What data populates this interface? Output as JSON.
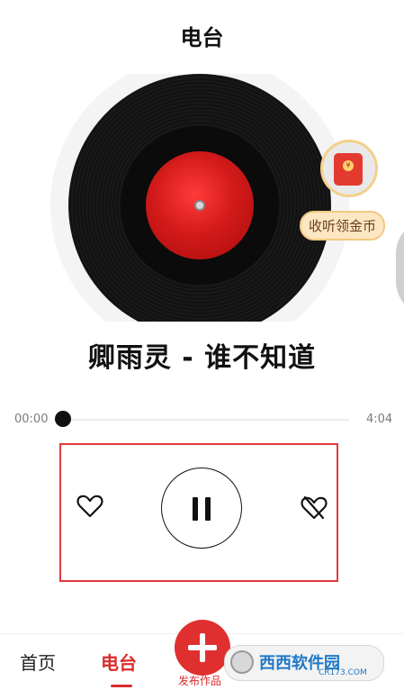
{
  "header": {
    "title": "电台"
  },
  "promo": {
    "coin_label": "收听领金币",
    "icon": "red-packet-icon"
  },
  "song": {
    "title": "卿雨灵 - 谁不知道"
  },
  "progress": {
    "current": "00:00",
    "total": "4:04",
    "fraction": 0.0
  },
  "controls": {
    "like_icon": "heart-icon",
    "play_state": "pause",
    "dislike_icon": "broken-heart-icon"
  },
  "bottom_nav": {
    "tabs": [
      {
        "label": "首页",
        "active": false
      },
      {
        "label": "电台",
        "active": true
      }
    ],
    "publish_label": "发布作品"
  },
  "watermark": {
    "text": "西西软件园",
    "sub": "CR173.COM"
  },
  "colors": {
    "accent": "#d92c2c",
    "highlight_box": "#e33a3a"
  }
}
